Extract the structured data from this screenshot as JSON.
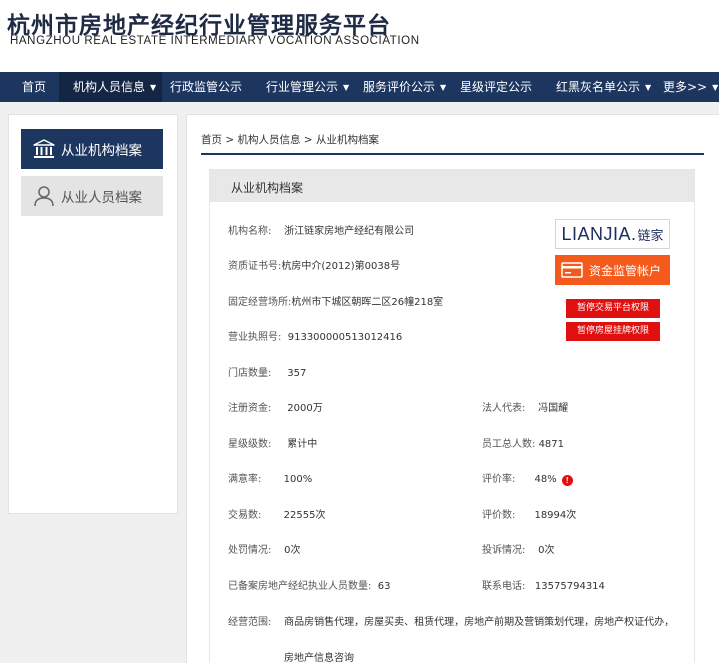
{
  "header": {
    "title_cn": "杭州市房地产经纪行业管理服务平台",
    "title_en": "HANGZHOU REAL ESTATE INTERMEDIARY VOCATION ASSOCIATION"
  },
  "nav": {
    "items": [
      {
        "label": "首页"
      },
      {
        "label": "机构人员信息"
      },
      {
        "label": "行政监管公示"
      },
      {
        "label": "行业管理公示"
      },
      {
        "label": "服务评价公示"
      },
      {
        "label": "星级评定公示"
      },
      {
        "label": "红黑灰名单公示"
      },
      {
        "label": "更多>>"
      }
    ]
  },
  "sidebar": {
    "items": [
      {
        "label": "从业机构档案",
        "icon": "institution-icon"
      },
      {
        "label": "从业人员档案",
        "icon": "person-icon"
      }
    ]
  },
  "breadcrumb": {
    "text": "首页 > 机构人员信息 > 从业机构档案"
  },
  "panel": {
    "title": "从业机构档案"
  },
  "brand": {
    "latin": "LIANJIA.",
    "cn": "链家"
  },
  "buttons": {
    "fund": "资金监管帐户",
    "suspend_trade": "暂停交易平台权限",
    "suspend_listing": "暂停房屋挂牌权限"
  },
  "fields": {
    "name": {
      "label": "机构名称:",
      "value": "浙江链家房地产经纪有限公司"
    },
    "cert": {
      "label": "资质证书号:",
      "value": "杭房中介(2012)第0038号"
    },
    "address": {
      "label": "固定经营场所:",
      "value": "杭州市下城区朝晖二区26幢218室"
    },
    "license": {
      "label": "营业执照号:",
      "value": "913300000513012416"
    },
    "stores": {
      "label": "门店数量:",
      "value": "357"
    },
    "capital": {
      "label": "注册资金:",
      "value": "2000万"
    },
    "legal_rep": {
      "label": "法人代表:",
      "value": "冯国耀"
    },
    "star": {
      "label": "星级级数:",
      "value": "累计中"
    },
    "staff": {
      "label": "员工总人数:",
      "value": "4871"
    },
    "satisfaction": {
      "label": "满意率:",
      "value": "100%"
    },
    "review_rate": {
      "label": "评价率:",
      "value": "48%"
    },
    "trades": {
      "label": "交易数:",
      "value": "22555次"
    },
    "reviews": {
      "label": "评价数:",
      "value": "18994次"
    },
    "penalty": {
      "label": "处罚情况:",
      "value": "0次"
    },
    "complaints": {
      "label": "投诉情况:",
      "value": "0次"
    },
    "registered_agents": {
      "label": "已备案房地产经纪执业人员数量:",
      "value": "63"
    },
    "phone": {
      "label": "联系电话:",
      "value": "13575794314"
    },
    "scope": {
      "label": "经营范围:",
      "value_line1": "商品房销售代理，房屋买卖、租赁代理，房地产前期及营销策划代理，房地产权证代办，",
      "value_line2": "房地产信息咨询"
    }
  },
  "colors": {
    "nav_bg": "#1d3660",
    "accent_orange": "#f35a1c",
    "alert_red": "#e01010"
  }
}
